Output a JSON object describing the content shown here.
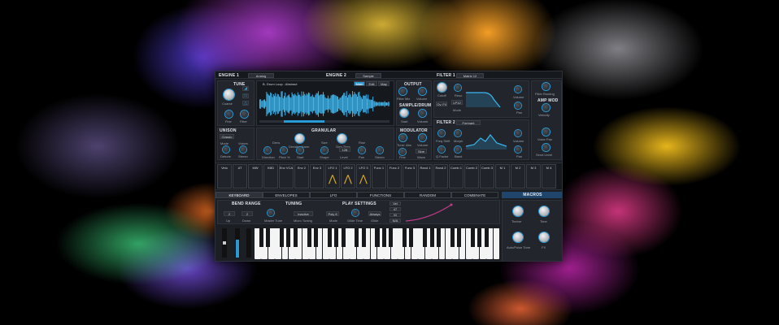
{
  "engine1": {
    "title": "ENGINE 1",
    "mode": "Analog"
  },
  "engine2": {
    "title": "ENGINE 2",
    "mode": "Sample",
    "sample_name": "B. Drum Loop : Abstract",
    "tabs": [
      "Main",
      "Edit",
      "Map"
    ]
  },
  "tune": {
    "title": "TUNE",
    "coarse": "Coarse",
    "fine": "Fine",
    "filter": "Filter"
  },
  "unison": {
    "title": "UNISON",
    "mode": "Classic",
    "labels": [
      "Mode",
      "Voices",
      "Detune",
      "Stereo"
    ]
  },
  "granular": {
    "title": "GRANULAR",
    "labels": [
      "Dens",
      "Density: Harm",
      "Size",
      "Size Time",
      "Rise",
      "Direction",
      "Pitch %",
      "Start",
      "Shape",
      "Level",
      "Pan",
      "Stereo"
    ],
    "size_value": "128"
  },
  "output": {
    "title": "OUTPUT",
    "labels": [
      "Filter Mix",
      "Volume"
    ],
    "sample_start": "SAMPLE/DRUM",
    "start_labels": [
      "Start",
      "Volume"
    ]
  },
  "modulator": {
    "title": "MODULATOR",
    "labels": [
      "Tune: Abs",
      "Volume",
      "Fine",
      "Wave"
    ],
    "wave": "Sine"
  },
  "filter1": {
    "title": "FILTER 1",
    "type": "Matrix 12",
    "labels": [
      "Cutoff",
      "Reso",
      "Mode",
      "Volume",
      "Pan"
    ],
    "mode": "LP12",
    "slope": "Ov. Fil"
  },
  "filter2": {
    "title": "FILTER 2",
    "type": "Formant",
    "labels": [
      "Freq Shift",
      "Morph",
      "Q Factor",
      "Band",
      "Volume",
      "Pan"
    ]
  },
  "routing": {
    "labels": [
      "Filter Routing",
      "Velocity",
      "Voice Pan",
      "Send Level"
    ],
    "amp_mod": "AMP MOD"
  },
  "mod_slots": [
    "Velo",
    "AT",
    "MW",
    "KBD",
    "Env VCA",
    "Env 2",
    "Env 3",
    "LFO 1",
    "LFO 2",
    "LFO 3",
    "Func 1",
    "Func 2",
    "Func 3",
    "Rand 1",
    "Rand 2",
    "Comb 1",
    "Comb 2",
    "Comb 3",
    "M 1",
    "M 2",
    "M 3",
    "M 4"
  ],
  "bottom_tabs": [
    "KEYBOARD",
    "ENVELOPES",
    "LFO",
    "FUNCTIONS",
    "RANDOM",
    "COMBINATE"
  ],
  "macros_title": "MACROS",
  "keyboard": {
    "bend_range": {
      "title": "BEND RANGE",
      "up": "2",
      "down": "2",
      "labels": [
        "Up",
        "Down"
      ]
    },
    "tuning": {
      "title": "TUNING",
      "value": "Inactive",
      "labels": [
        "Master Tune",
        "Micro Tuning"
      ]
    },
    "play": {
      "title": "PLAY SETTINGS",
      "poly": "Poly 8",
      "always": "Always",
      "labels": [
        "Mode",
        "Glide Time",
        "Glide"
      ]
    },
    "vel": [
      "Vel",
      "47",
      "M",
      "N/A"
    ]
  },
  "macros": [
    "Timbre",
    "Time",
    "Auto/Pulse Tone",
    "FX"
  ],
  "colors": {
    "accent": "#2a9ad6",
    "wave": "#3bb6ee",
    "mod": "#c23a8c",
    "panel": "#1b1e23"
  }
}
